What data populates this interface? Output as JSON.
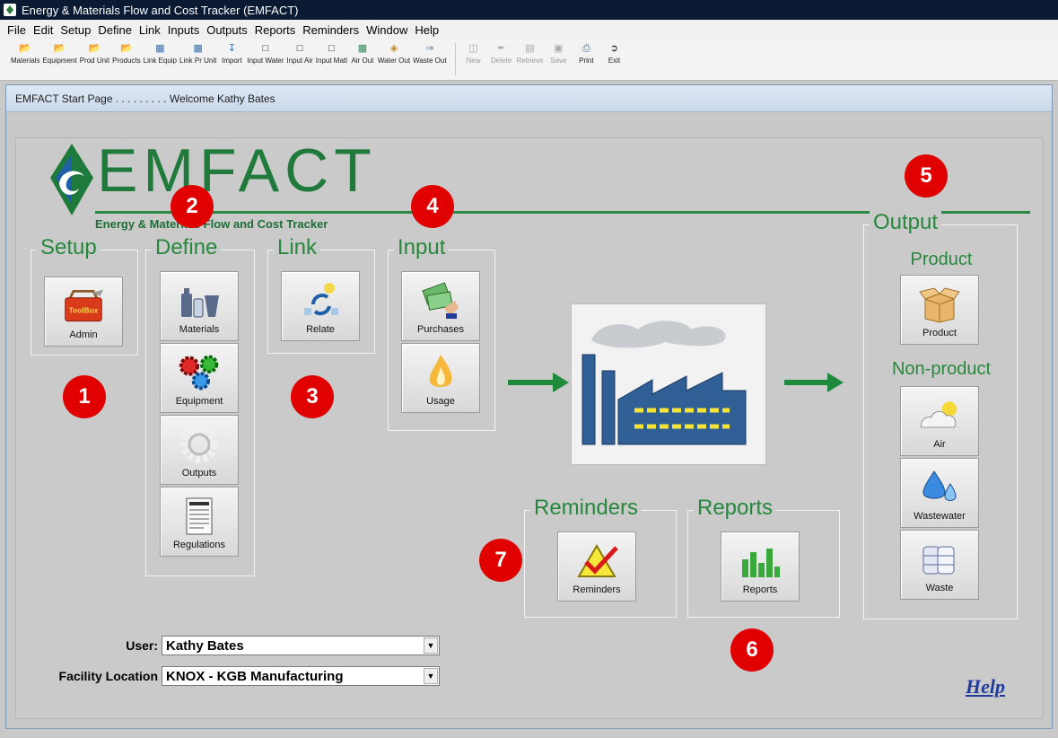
{
  "window": {
    "title": "Energy & Materials Flow and Cost Tracker (EMFACT)"
  },
  "menu": [
    "File",
    "Edit",
    "Setup",
    "Define",
    "Link",
    "Inputs",
    "Outputs",
    "Reports",
    "Reminders",
    "Window",
    "Help"
  ],
  "toolbar": [
    {
      "label": "Materials",
      "icon": "folder-icon",
      "enabled": true
    },
    {
      "label": "Equipment",
      "icon": "folder-icon",
      "enabled": true
    },
    {
      "label": "Prod Unit",
      "icon": "folder-icon",
      "enabled": true
    },
    {
      "label": "Products",
      "icon": "folder-icon",
      "enabled": true
    },
    {
      "label": "Link Equip",
      "icon": "form-icon",
      "enabled": true
    },
    {
      "label": "Link Pr Unit",
      "icon": "form-icon",
      "enabled": true
    },
    {
      "label": "Import",
      "icon": "import-icon",
      "enabled": true
    },
    {
      "label": "Input Water",
      "icon": "blank-icon",
      "enabled": true
    },
    {
      "label": "Input Air",
      "icon": "blank-icon",
      "enabled": true
    },
    {
      "label": "Input Matl",
      "icon": "blank-icon",
      "enabled": true
    },
    {
      "label": "Air Out",
      "icon": "air-out-icon",
      "enabled": true
    },
    {
      "label": "Water Out",
      "icon": "water-out-icon",
      "enabled": true
    },
    {
      "label": "Waste Out",
      "icon": "waste-out-icon",
      "enabled": true
    },
    {
      "label": "New",
      "icon": "new-icon",
      "enabled": false
    },
    {
      "label": "Delete",
      "icon": "delete-icon",
      "enabled": false
    },
    {
      "label": "Retrieve",
      "icon": "retrieve-icon",
      "enabled": false
    },
    {
      "label": "Save",
      "icon": "save-icon",
      "enabled": false
    },
    {
      "label": "Print",
      "icon": "print-icon",
      "enabled": true
    },
    {
      "label": "Exit",
      "icon": "exit-icon",
      "enabled": true
    }
  ],
  "page": {
    "title": "EMFACT Start Page . . . . . . . . . Welcome Kathy Bates",
    "logo_text": "EMFACT",
    "logo_subtitle": "Energy & Materials Flow and Cost Tracker"
  },
  "groups": {
    "setup": {
      "title": "Setup",
      "buttons": [
        "Admin"
      ]
    },
    "define": {
      "title": "Define",
      "buttons": [
        "Materials",
        "Equipment",
        "Outputs",
        "Regulations"
      ]
    },
    "link": {
      "title": "Link",
      "buttons": [
        "Relate"
      ]
    },
    "input": {
      "title": "Input",
      "buttons": [
        "Purchases",
        "Usage"
      ]
    },
    "output": {
      "title": "Output",
      "product_label": "Product",
      "nonproduct_label": "Non-product",
      "buttons": [
        "Product",
        "Air",
        "Wastewater",
        "Waste"
      ]
    },
    "reminders": {
      "title": "Reminders",
      "buttons": [
        "Reminders"
      ]
    },
    "reports": {
      "title": "Reports",
      "buttons": [
        "Reports"
      ]
    }
  },
  "toolbox_label": "ToolBox",
  "badges": [
    "1",
    "2",
    "3",
    "4",
    "5",
    "6",
    "7"
  ],
  "form": {
    "user_label": "User:",
    "user_value": "Kathy Bates",
    "facility_label": "Facility Location",
    "facility_value": "KNOX - KGB Manufacturing"
  },
  "help_label": "Help",
  "colors": {
    "accent_green": "#27873d",
    "badge_red": "#e00000",
    "help_blue": "#1f3c9a"
  }
}
